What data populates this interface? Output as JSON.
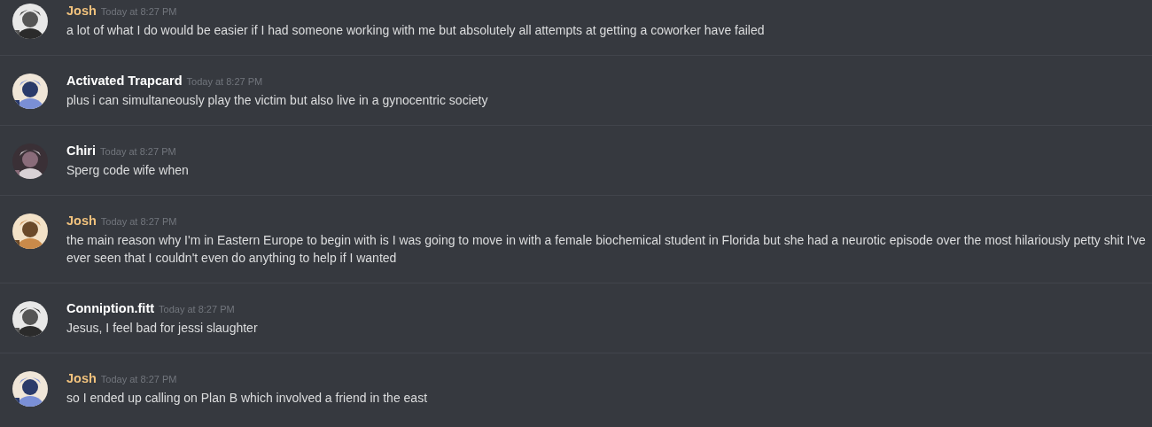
{
  "messages": [
    {
      "author": "Josh",
      "color": "#f1c27d",
      "timestamp": "Today at 8:27 PM",
      "text": "a lot of what I do would be easier if I had someone working with me but absolutely all attempts at getting a coworker have failed"
    },
    {
      "author": "Activated Trapcard",
      "color": "#ffffff",
      "timestamp": "Today at 8:27 PM",
      "text": "plus i can simultaneously play the victim but also live in a gynocentric society"
    },
    {
      "author": "Chiri",
      "color": "#ffffff",
      "timestamp": "Today at 8:27 PM",
      "text": "Sperg code wife when"
    },
    {
      "author": "Josh",
      "color": "#f1c27d",
      "timestamp": "Today at 8:27 PM",
      "text": "the main reason why I'm in Eastern Europe to begin with is I was going to move in with a female biochemical student in Florida but she had a neurotic episode over the most hilariously petty shit I've\never seen that I couldn't even do anything to help if I wanted"
    },
    {
      "author": "Conniption.fitt",
      "color": "#ffffff",
      "timestamp": "Today at 8:27 PM",
      "text": "Jesus, I feel bad for jessi slaughter"
    },
    {
      "author": "Josh",
      "color": "#f1c27d",
      "timestamp": "Today at 8:27 PM",
      "text": "so I ended up calling on Plan B which involved a friend in the east"
    }
  ]
}
